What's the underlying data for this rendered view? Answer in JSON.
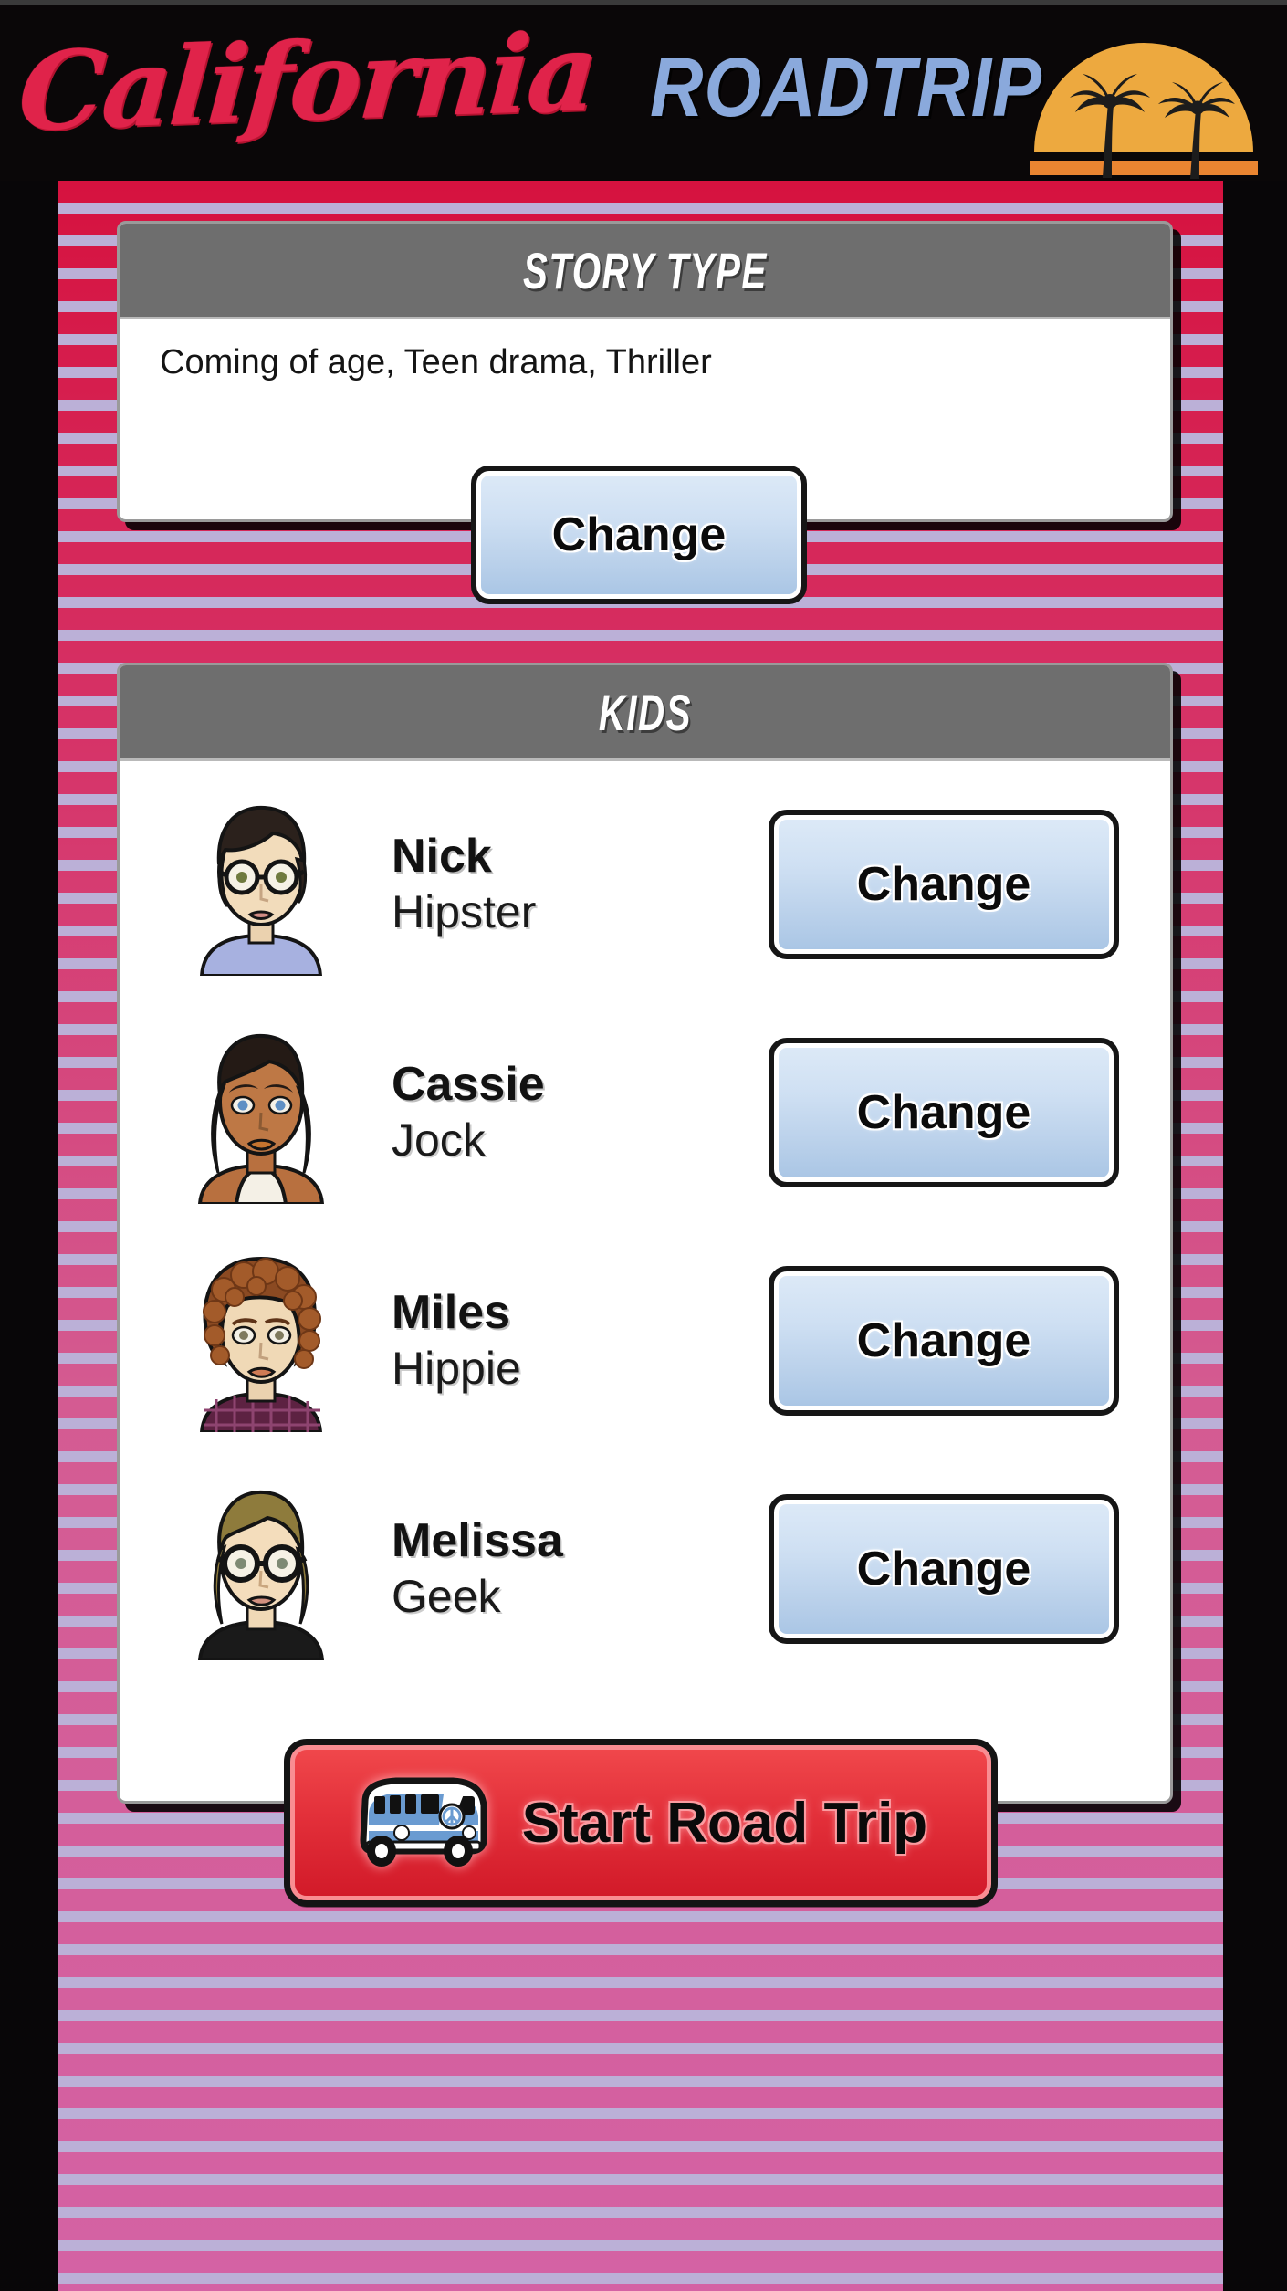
{
  "header": {
    "logo_script": "California",
    "logo_block": "ROADTRIP",
    "sunset_icon": "sunset-palms-icon"
  },
  "story_panel": {
    "title": "STORY TYPE",
    "value": "Coming of age, Teen drama, Thriller",
    "change_label": "Change"
  },
  "kids_panel": {
    "title": "KIDS",
    "rows": [
      {
        "name": "Nick",
        "role": "Hipster",
        "change_label": "Change",
        "avatar_icon": "avatar-nick-icon"
      },
      {
        "name": "Cassie",
        "role": "Jock",
        "change_label": "Change",
        "avatar_icon": "avatar-cassie-icon"
      },
      {
        "name": "Miles",
        "role": "Hippie",
        "change_label": "Change",
        "avatar_icon": "avatar-miles-icon"
      },
      {
        "name": "Melissa",
        "role": "Geek",
        "change_label": "Change",
        "avatar_icon": "avatar-melissa-icon"
      }
    ]
  },
  "start_button": {
    "label": "Start Road Trip",
    "icon": "vw-bus-icon"
  },
  "colors": {
    "logo_red": "#E0234A",
    "logo_blue": "#8AA9DC",
    "sun_orange": "#EDA93F",
    "sun_band": "#EA8531",
    "stripe_pink": "#D45B92",
    "stripe_crimson": "#D6123F",
    "stripe_lavender": "#BBB0D7",
    "panel_header_gray": "#6E6E6E",
    "button_blue": "#CFE0F3",
    "start_red": "#E3303A"
  }
}
